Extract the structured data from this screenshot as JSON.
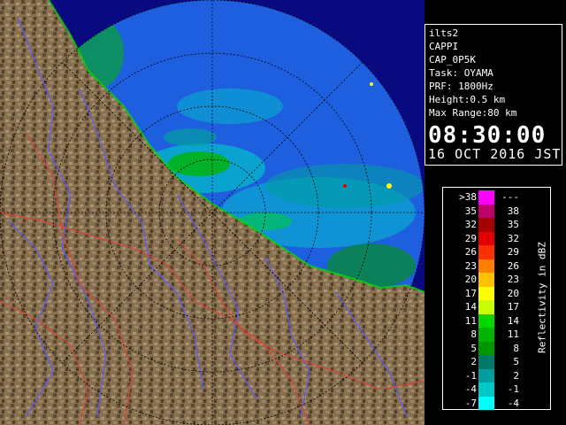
{
  "info": {
    "lines": [
      "ilts2",
      "CAPPI",
      "CAP_0P5K",
      "Task: OYAMA",
      "PRF: 1800Hz",
      "Height:0.5 km",
      "Max Range:80 km"
    ],
    "time": "08:30:00",
    "date": "16 OCT 2016 JST"
  },
  "legend": {
    "title": "Reflectivity in dBZ",
    "rows": [
      {
        "lo": ">38",
        "hi": "---",
        "color": "#ff00ff"
      },
      {
        "lo": "35",
        "hi": "38",
        "color": "#c0006a"
      },
      {
        "lo": "32",
        "hi": "35",
        "color": "#a80000"
      },
      {
        "lo": "29",
        "hi": "32",
        "color": "#e00000"
      },
      {
        "lo": "26",
        "hi": "29",
        "color": "#ff3000"
      },
      {
        "lo": "23",
        "hi": "26",
        "color": "#ff8000"
      },
      {
        "lo": "20",
        "hi": "23",
        "color": "#ffc000"
      },
      {
        "lo": "17",
        "hi": "20",
        "color": "#ffff00"
      },
      {
        "lo": "14",
        "hi": "17",
        "color": "#c8ff00"
      },
      {
        "lo": "11",
        "hi": "14",
        "color": "#00d800"
      },
      {
        "lo": "8",
        "hi": "11",
        "color": "#00b400"
      },
      {
        "lo": "5",
        "hi": "8",
        "color": "#009600"
      },
      {
        "lo": "2",
        "hi": "5",
        "color": "#00786a"
      },
      {
        "lo": "-1",
        "hi": "2",
        "color": "#009e9e"
      },
      {
        "lo": "-4",
        "hi": "-1",
        "color": "#00c8c8"
      },
      {
        "lo": "-7",
        "hi": "-4",
        "color": "#00ffff"
      }
    ]
  },
  "colors": {
    "sea": "#1e5fe0",
    "sea_outside": "#0a0a80",
    "land": "#8a7050",
    "rivers": "#5a5aff",
    "borders": "#e0403a",
    "range_rings": "#000000"
  }
}
